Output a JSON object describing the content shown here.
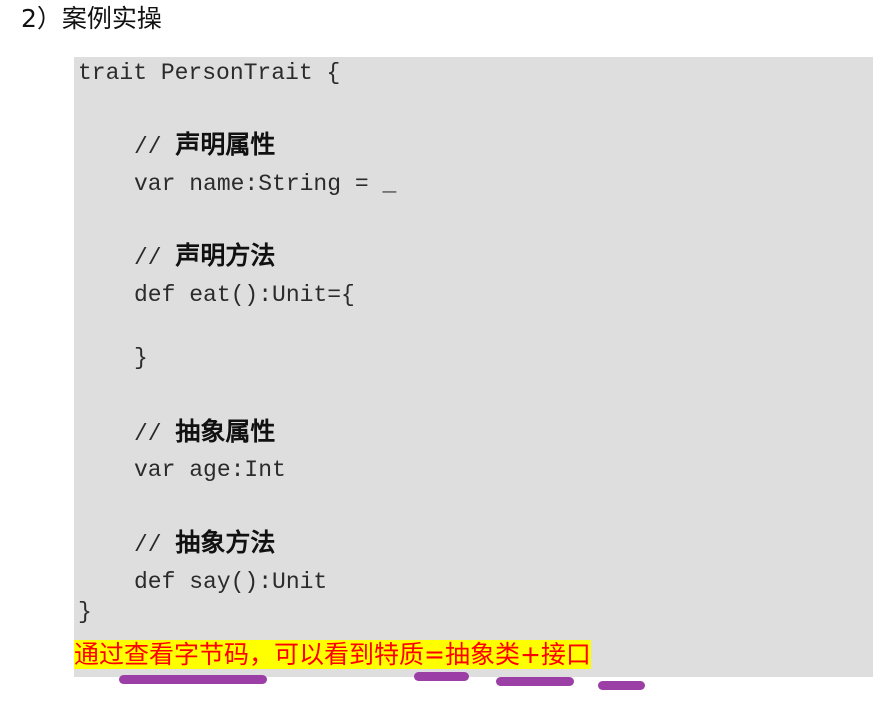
{
  "heading": "2）案例实操",
  "code": {
    "line1": "trait PersonTrait {",
    "comment1_slash": "// ",
    "comment1_text": "声明属性",
    "line_var_name": "var name:String = _",
    "comment2_slash": "// ",
    "comment2_text": "声明方法",
    "line_def_eat": "def eat():Unit={",
    "line_close_inner": "}",
    "comment3_slash": "// ",
    "comment3_text": "抽象属性",
    "line_var_age": "var age:Int",
    "comment4_slash": "// ",
    "comment4_text": "抽象方法",
    "line_def_say": "def say():Unit",
    "line_close_outer": "}"
  },
  "note": {
    "text": "通过查看字节码，可以看到特质=抽象类+接口"
  },
  "colors": {
    "code_background": "#dedede",
    "highlight": "#ffff00",
    "note_text": "#ff0000",
    "underline_mark": "#9b3fa6"
  }
}
